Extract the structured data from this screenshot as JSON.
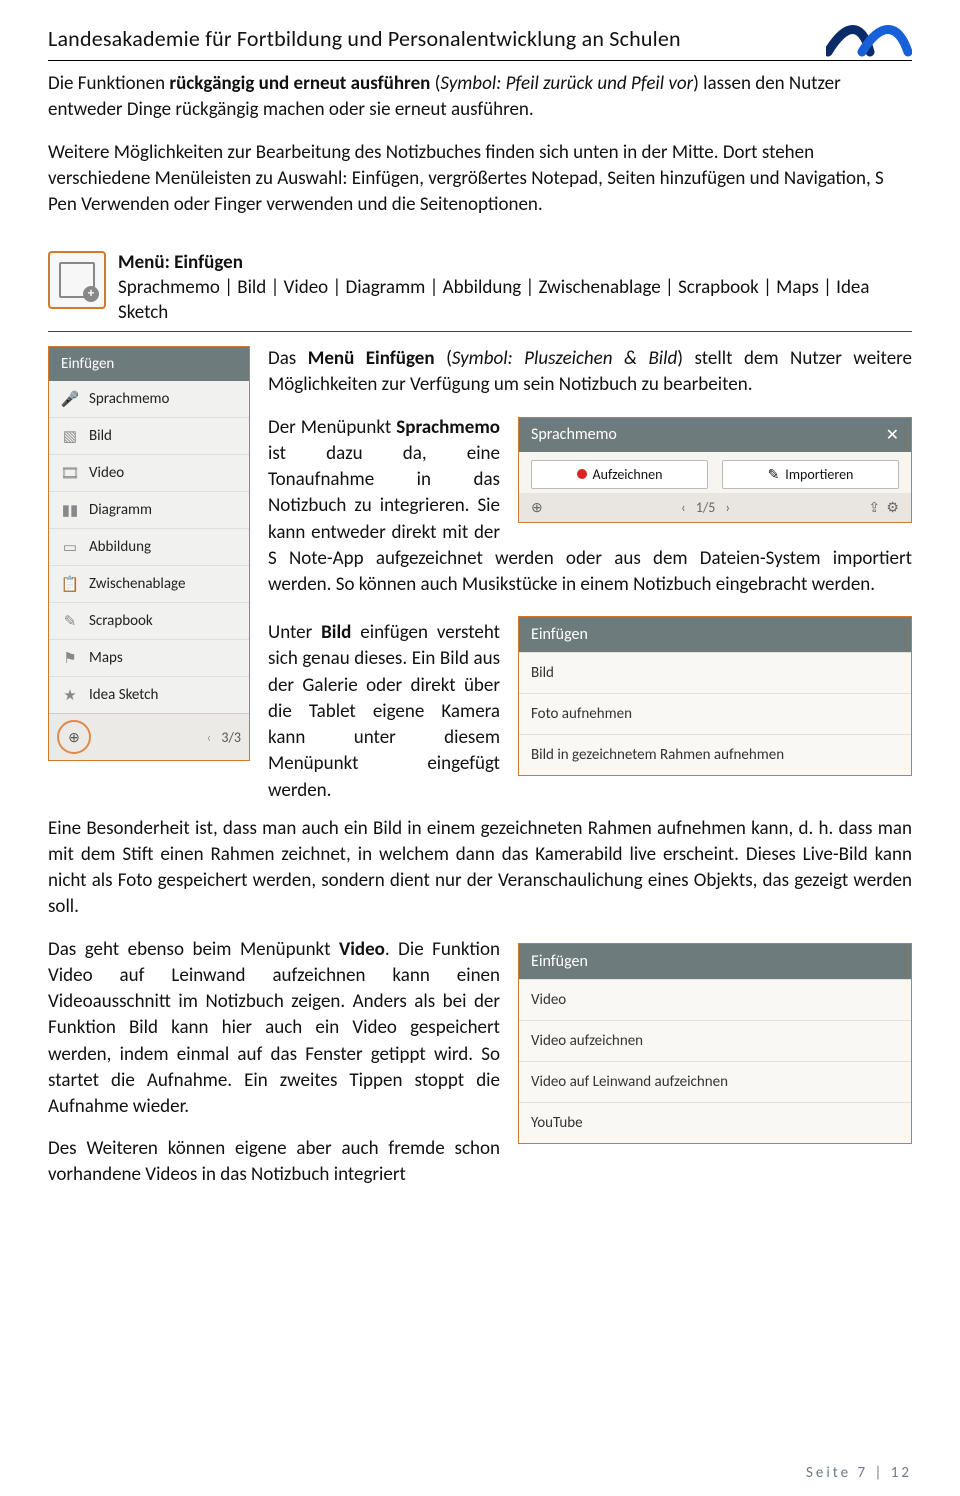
{
  "header": {
    "title": "Landesakademie für Fortbildung und Personalentwicklung an Schulen"
  },
  "intro": {
    "p1_pre": "Die Funktionen ",
    "p1_bold": "rückgängig und erneut ausführen",
    "p1_ital": "Symbol: Pfeil zurück und Pfeil vor",
    "p1_post": ") lassen den Nutzer entweder Dinge rückgängig machen oder sie erneut ausführen.",
    "p2": "Weitere Möglichkeiten zur Bearbeitung des Notizbuches finden sich unten in der Mitte. Dort stehen verschiedene Menüleisten zu Auswahl: Einfügen, vergrößertes Notepad, Seiten hinzufügen und Navigation, S Pen Verwenden oder Finger verwenden und die Seitenoptionen."
  },
  "section": {
    "title": "Menü: Einfügen",
    "subtitle": "Sprachmemo | Bild | Video | Diagramm | Abbildung | Zwischenablage | Scrapbook | Maps | Idea Sketch"
  },
  "einfmenu": {
    "title": "Einfügen",
    "items": [
      {
        "icon": "🎤",
        "label": "Sprachmemo"
      },
      {
        "icon": "▧",
        "label": "Bild"
      },
      {
        "icon": "🎞",
        "label": "Video"
      },
      {
        "icon": "▮▮",
        "label": "Diagramm"
      },
      {
        "icon": "▭",
        "label": "Abbildung"
      },
      {
        "icon": "📋",
        "label": "Zwischenablage"
      },
      {
        "icon": "✎",
        "label": "Scrapbook"
      },
      {
        "icon": "⚑",
        "label": "Maps"
      },
      {
        "icon": "★",
        "label": "Idea Sketch"
      }
    ],
    "pager": "3/3"
  },
  "einfpara": {
    "lead_pre": "Das ",
    "lead_bold": "Menü Einfügen",
    "lead_ital": "Symbol: Pluszeichen & Bild",
    "lead_post": ") stellt dem Nutzer weitere Möglichkeiten zur Verfügung um sein Notizbuch zu bearbeiten."
  },
  "voice": {
    "title": "Sprachmemo",
    "rec": "Aufzeichnen",
    "imp": "Importieren",
    "pager": "1/5",
    "para_pre": "Der Menüpunkt ",
    "para_bold": "Sprachmemo",
    "para_mid": " ist dazu da, eine Tonaufnahme in das Notizbuch zu integrieren. Sie kann entweder direkt mit der S Note-App aufgezeichnet werden oder aus dem Dateien-System importiert werden. So können auch Musikstücke in einem Notizbuch eingebracht werden."
  },
  "bild": {
    "head": "Einfügen",
    "r1": "Bild",
    "r2": "Foto aufnehmen",
    "r3": "Bild in gezeichnetem Rahmen aufnehmen",
    "para_a_pre": "Unter ",
    "para_a_bold": "Bild",
    "para_a_post": " einfügen versteht sich genau dieses. Ein Bild aus der Galerie oder direkt über die Tablet eigene Kamera kann unter diesem Menüpunkt eingefügt werden.",
    "para_b": "Eine Besonderheit ist, dass man auch ein Bild in einem gezeichneten Rahmen aufnehmen kann, d. h. dass man mit dem Stift einen Rahmen zeichnet, in welchem dann das Kamerabild live erscheint. Dieses Live-Bild kann nicht als Foto gespeichert werden, sondern dient nur der Veranschaulichung eines Objekts, das gezeigt werden soll."
  },
  "video": {
    "head": "Einfügen",
    "r1": "Video",
    "r2": "Video aufzeichnen",
    "r3": "Video auf Leinwand aufzeichnen",
    "r4": "YouTube",
    "para_pre": "Das geht ebenso beim Menüpunkt ",
    "para_bold": "Video",
    "para_post": ". Die Funktion Video auf Leinwand aufzeichnen kann einen Videoausschnitt im Notizbuch zeigen. Anders als bei der Funktion Bild kann hier auch ein Video gespeichert werden, indem einmal auf das Fenster getippt wird. So startet die Aufnahme. Ein zweites Tippen stoppt die Aufnahme wieder.",
    "para2": "Des Weiteren können eigene aber auch fremde schon vorhandene Videos in das Notizbuch integriert"
  },
  "footer": {
    "label": "Seite 7 | 12"
  }
}
